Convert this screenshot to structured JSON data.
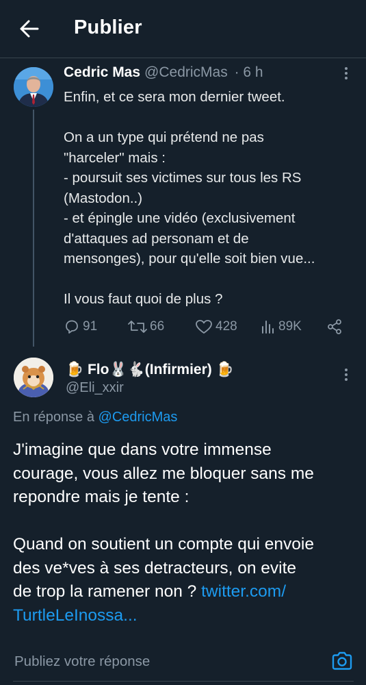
{
  "header": {
    "title": "Publier",
    "back_icon": "arrow-left-icon"
  },
  "tweet1": {
    "name": "Cedric Mas",
    "handle": "@CedricMas",
    "time": "· 6 h",
    "lines": [
      "Enfin, et ce sera mon dernier tweet.",
      "",
      "On a un type qui prétend ne pas",
      "\"harceler\" mais :",
      "- poursuit ses victimes sur tous les RS",
      "(Mastodon..)",
      "- et épingle une vidéo (exclusivement",
      "d'attaques ad personam et de",
      "mensonges), pour qu'elle soit bien vue...",
      "",
      "Il vous faut quoi de plus ?"
    ],
    "stats": {
      "replies": "91",
      "retweets": "66",
      "likes": "428",
      "views": "89K"
    }
  },
  "tweet2": {
    "name": "🍺 Flo🐰🐇(Infirmier) 🍺",
    "handle": "@Eli_xxir",
    "reply_prefix": "En réponse à ",
    "reply_handle": "@CedricMas",
    "lines": [
      "J'imagine que dans votre immense",
      "courage, vous allez me bloquer sans me",
      "repondre mais je tente :",
      "",
      "Quand on soutient un compte qui envoie",
      "des ve*ves à ses detracteurs, on evite",
      "de trop la ramener non ?"
    ],
    "link_part1": "twitter.com/",
    "link_part2": "TurtleLeInossa..."
  },
  "compose": {
    "placeholder": "Publiez votre réponse",
    "camera_icon": "camera-icon"
  },
  "colors": {
    "background": "#15202b",
    "accent": "#1d9bf0",
    "muted": "#8b98a5",
    "divider": "#38444d"
  }
}
